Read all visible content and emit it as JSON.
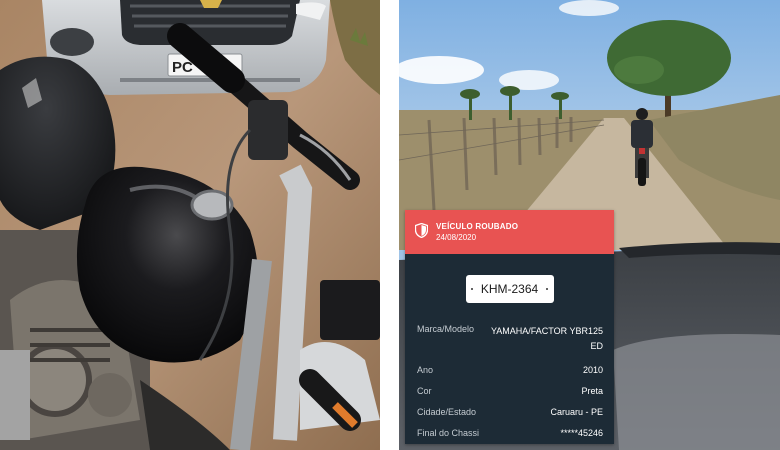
{
  "card": {
    "header_title": "VEÍCULO ROUBADO",
    "header_date": "24/08/2020",
    "plate": "KHM-2364",
    "rows": [
      {
        "label": "Marca/Modelo",
        "value": "YAMAHA/FACTOR YBR125 ED"
      },
      {
        "label": "Ano",
        "value": "2010"
      },
      {
        "label": "Cor",
        "value": "Preta"
      },
      {
        "label": "Cidade/Estado",
        "value": "Caruaru - PE"
      },
      {
        "label": "Final do Chassi",
        "value": "*****45246"
      }
    ],
    "colors": {
      "header": "#e85352",
      "body": "#1d2b36",
      "plate_bg": "#ffffff"
    }
  },
  "left_photo": {
    "car_plate_text": "PC"
  },
  "icons": {
    "shield": "shield-icon"
  }
}
